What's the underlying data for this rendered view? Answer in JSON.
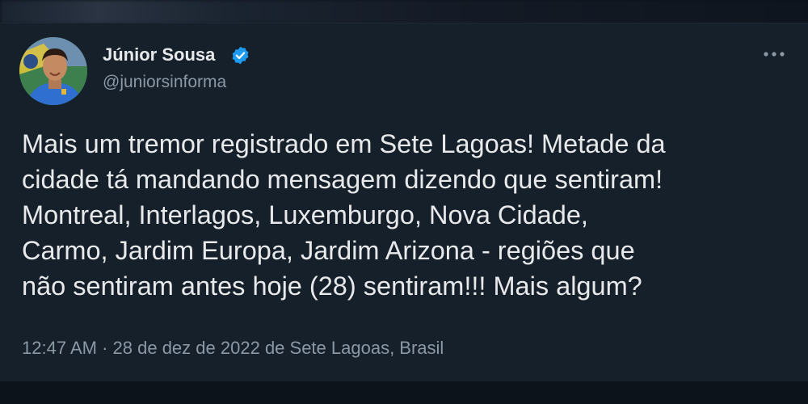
{
  "tweet": {
    "author": {
      "display_name": "Júnior Sousa",
      "handle": "@juniorsinforma",
      "verified": true,
      "avatar_icon": "profile-photo"
    },
    "menu_icon": "more-options-icon",
    "text": "Mais um tremor registrado em Sete Lagoas! Metade da\ncidade tá mandando mensagem dizendo que sentiram!\nMontreal, Interlagos, Luxemburgo, Nova Cidade,\nCarmo, Jardim Europa, Jardim Arizona - regiões que\nnão sentiram antes hoje (28) sentiram!!! Mais algum?",
    "meta": {
      "time": "12:47 AM",
      "separator": "·",
      "date": "28 de dez de 2022",
      "location": "de Sete Lagoas, Brasil"
    }
  },
  "colors": {
    "background": "#15202b",
    "primary_text": "#e7e9ea",
    "secondary_text": "#8b98a5",
    "verified_badge": "#1d9bf0"
  }
}
